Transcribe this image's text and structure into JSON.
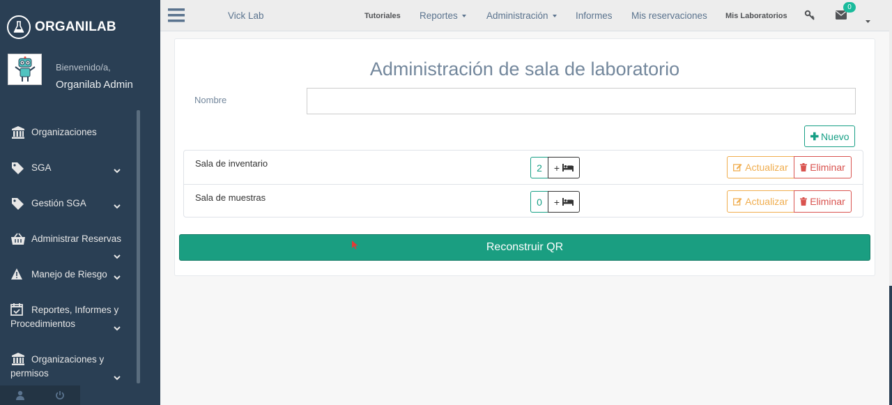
{
  "brand": {
    "name": "ORGANILAB",
    "icon": "flask-icon"
  },
  "profile": {
    "welcome": "Bienvenido/a,",
    "name": "Organilab Admin",
    "avatar": "robot-avatar"
  },
  "sidebar": {
    "items": [
      {
        "label": "Organizaciones",
        "icon": "institution-icon",
        "expandable": false
      },
      {
        "label": "SGA",
        "icon": "tags-icon",
        "expandable": true
      },
      {
        "label": "Gestión SGA",
        "icon": "tags-icon",
        "expandable": true
      },
      {
        "label": "Administrar Reservas",
        "icon": "basket-icon",
        "expandable": true
      },
      {
        "label": "Manejo de Riesgo",
        "icon": "warning-icon",
        "expandable": true
      },
      {
        "label": "Reportes, Informes y Procedimientos",
        "icon": "calendar-check-icon",
        "expandable": true
      },
      {
        "label": "Organizaciones y permisos",
        "icon": "institution-icon",
        "expandable": true
      }
    ]
  },
  "topnav": {
    "lab": "Vick Lab",
    "links": {
      "tutoriales": "Tutoriales",
      "reportes": "Reportes",
      "administracion": "Administración",
      "informes": "Informes",
      "reservaciones": "Mis reservaciones",
      "laboratorios": "Mis Laboratorios"
    },
    "messages_count": "0"
  },
  "main": {
    "title": "Administración de sala de laboratorio",
    "form": {
      "name_label": "Nombre",
      "name_value": ""
    },
    "new_button": "Nuevo",
    "rooms": [
      {
        "name": "Sala de inventario",
        "count": "2"
      },
      {
        "name": "Sala de muestras",
        "count": "0"
      }
    ],
    "add_label": "+",
    "update_label": "Actualizar",
    "delete_label": "Eliminar",
    "qr_button": "Reconstruir QR"
  },
  "colors": {
    "sidebar": "#2a3f54",
    "accent": "#1a9e81",
    "warning": "#f0ad4e",
    "danger": "#d9534f"
  }
}
